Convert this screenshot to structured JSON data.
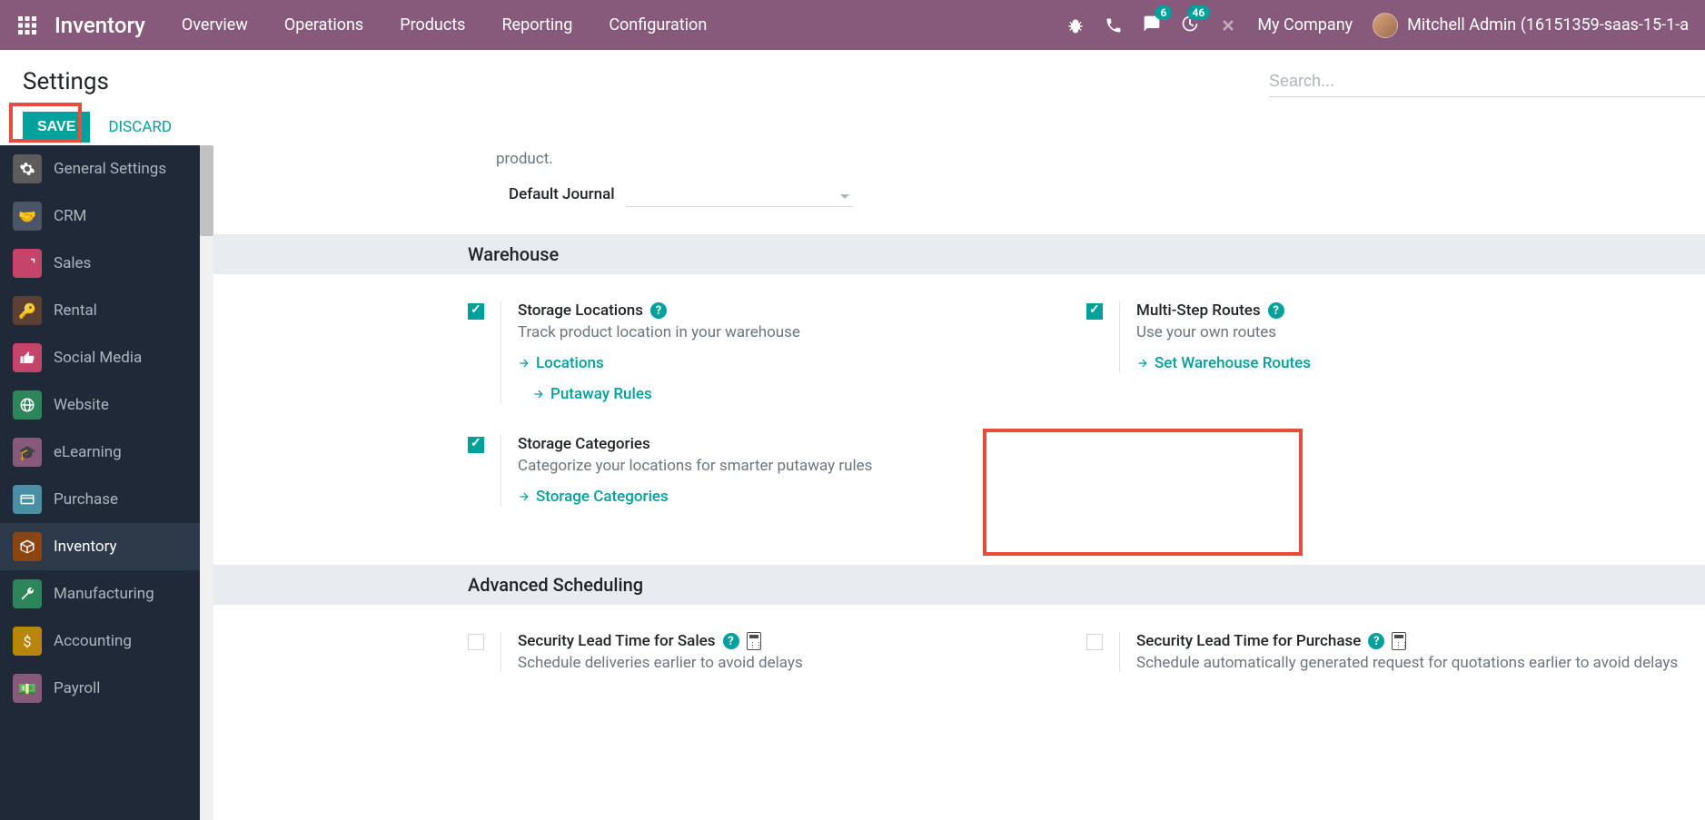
{
  "topbar": {
    "brand": "Inventory",
    "nav": [
      "Overview",
      "Operations",
      "Products",
      "Reporting",
      "Configuration"
    ],
    "msg_badge": "6",
    "activity_badge": "46",
    "company": "My Company",
    "user": "Mitchell Admin (16151359-saas-15-1-a"
  },
  "header": {
    "title": "Settings",
    "save": "SAVE",
    "discard": "DISCARD",
    "search_placeholder": "Search..."
  },
  "sidebar": [
    "General Settings",
    "CRM",
    "Sales",
    "Rental",
    "Social Media",
    "Website",
    "eLearning",
    "Purchase",
    "Inventory",
    "Manufacturing",
    "Accounting",
    "Payroll"
  ],
  "truncated": "product.",
  "journal_label": "Default Journal",
  "sections": {
    "warehouse": {
      "title": "Warehouse",
      "storage_loc": {
        "title": "Storage Locations",
        "desc": "Track product location in your warehouse",
        "link1": "Locations",
        "link2": "Putaway Rules"
      },
      "routes": {
        "title": "Multi-Step Routes",
        "desc": "Use your own routes",
        "link": "Set Warehouse Routes"
      },
      "categories": {
        "title": "Storage Categories",
        "desc": "Categorize your locations for smarter putaway rules",
        "link": "Storage Categories"
      }
    },
    "scheduling": {
      "title": "Advanced Scheduling",
      "sales": {
        "title": "Security Lead Time for Sales",
        "desc": "Schedule deliveries earlier to avoid delays"
      },
      "purchase": {
        "title": "Security Lead Time for Purchase",
        "desc": "Schedule automatically generated request for quotations earlier to avoid delays"
      }
    }
  }
}
